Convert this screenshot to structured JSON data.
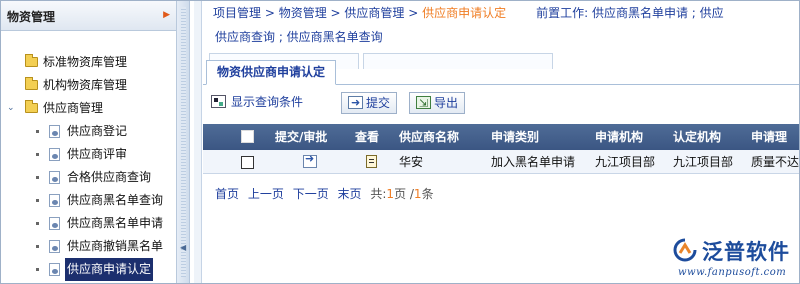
{
  "sidebar": {
    "title": "物资管理",
    "items": [
      {
        "label": "标准物资库管理"
      },
      {
        "label": "机构物资库管理"
      },
      {
        "label": "供应商管理"
      },
      {
        "label": "供应商登记"
      },
      {
        "label": "供应商评审"
      },
      {
        "label": "合格供应商查询"
      },
      {
        "label": "供应商黑名单查询"
      },
      {
        "label": "供应商黑名单申请"
      },
      {
        "label": "供应商撤销黑名单"
      },
      {
        "label": "供应商申请认定"
      }
    ]
  },
  "breadcrumb": {
    "part1": "项目管理",
    "part2": "物资管理",
    "part3": "供应商管理",
    "current": "供应商申请认定",
    "separator": " > ",
    "prereq": "前置工作: 供应商黑名单申请 ; 供应"
  },
  "sublinks": "供应商查询 ; 供应商黑名单查询",
  "tab": {
    "label": "物资供应商申请认定"
  },
  "toolbar": {
    "show_query": "显示查询条件",
    "submit": "提交",
    "export": "导出"
  },
  "table": {
    "headers": [
      "提交/审批",
      "查看",
      "供应商名称",
      "申请类别",
      "申请机构",
      "认定机构",
      "申请理"
    ],
    "rows": [
      {
        "name": "华安",
        "category": "加入黑名单申请",
        "apply_org": "九江项目部",
        "cert_org": "九江项目部",
        "reason": "质量不达"
      }
    ]
  },
  "pager": {
    "first": "首页",
    "prev": "上一页",
    "next": "下一页",
    "last": "末页",
    "total_prefix": "共:",
    "current_page": "1",
    "page_unit": "页 /",
    "total_items": "1",
    "item_unit": "条"
  },
  "logo": {
    "name": "泛普软件",
    "url": "www.fanpusoft.com",
    "color": "#1d4c9c"
  }
}
